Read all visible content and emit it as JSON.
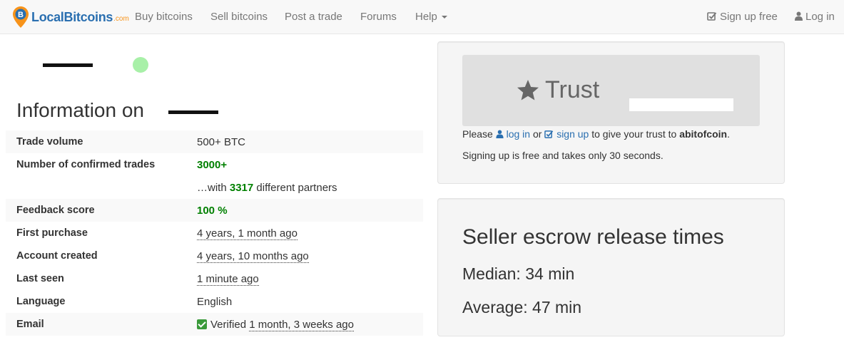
{
  "navbar": {
    "brand": "LocalBitcoins",
    "brand_domain": ".com",
    "links": [
      "Buy bitcoins",
      "Sell bitcoins",
      "Post a trade",
      "Forums",
      "Help"
    ],
    "sign_up": "Sign up free",
    "log_in": "Log in"
  },
  "info": {
    "title": "Information on",
    "rows": {
      "trade_volume": {
        "label": "Trade volume",
        "value": "500+ BTC"
      },
      "confirmed_trades": {
        "label": "Number of confirmed trades",
        "value": "3000+"
      },
      "partners": {
        "prefix": "…with",
        "count": "3317",
        "suffix": "different partners"
      },
      "feedback": {
        "label": "Feedback score",
        "value": "100 %"
      },
      "first_purchase": {
        "label": "First purchase",
        "value": "4 years, 1 month ago"
      },
      "account_created": {
        "label": "Account created",
        "value": "4 years, 10 months ago"
      },
      "last_seen": {
        "label": "Last seen",
        "value": "1 minute ago"
      },
      "language": {
        "label": "Language",
        "value": "English"
      },
      "email": {
        "label": "Email",
        "status": "Verified",
        "value": "1 month, 3 weeks ago"
      }
    }
  },
  "trust": {
    "button_label": "Trust",
    "please": "Please",
    "log_in": "log in",
    "or": "or",
    "sign_up": "sign up",
    "suffix": "to give your trust to",
    "username": "abitofcoin",
    "period": ".",
    "note": "Signing up is free and takes only 30 seconds."
  },
  "escrow": {
    "title": "Seller escrow release times",
    "median": "Median: 34 min",
    "average": "Average: 47 min"
  },
  "colors": {
    "brand": "#2a6fb0",
    "accent": "#f7931a",
    "positive": "#008000"
  }
}
